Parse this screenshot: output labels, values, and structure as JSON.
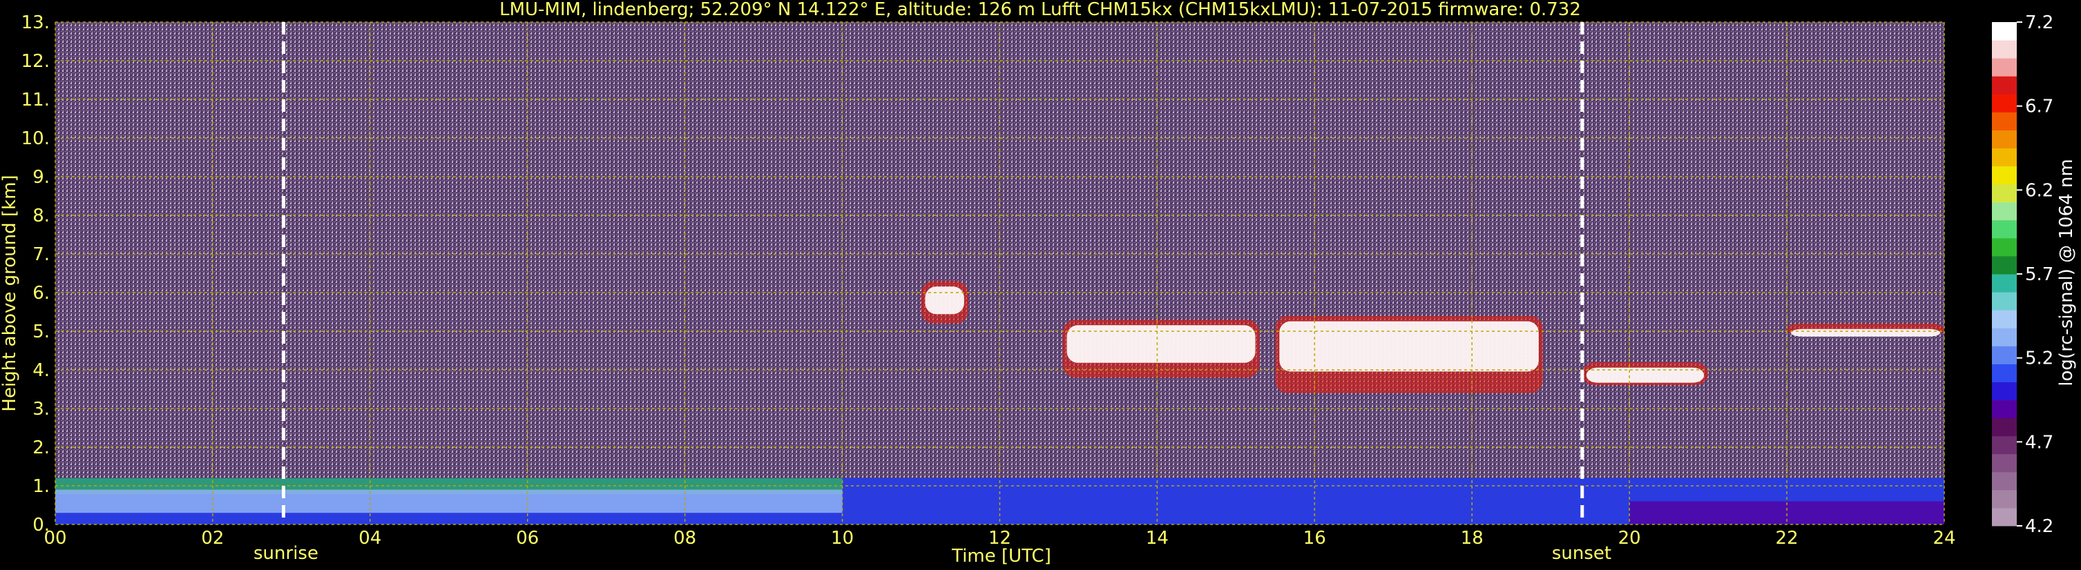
{
  "title": "LMU-MIM, lindenberg; 52.209° N 14.122° E, altitude: 126 m    Lufft CHM15kx (CHM15kxLMU): 11-07-2015    firmware: 0.732",
  "chart_data": {
    "type": "heatmap",
    "title": "LMU-MIM, lindenberg; 52.209° N 14.122° E, altitude: 126 m    Lufft CHM15kx (CHM15kxLMU): 11-07-2015    firmware: 0.732",
    "xlabel": "Time [UTC]",
    "ylabel": "Height above ground [km]",
    "xlim": [
      0,
      24
    ],
    "ylim": [
      0,
      13
    ],
    "x_ticks": [
      "00",
      "02",
      "04",
      "06",
      "08",
      "10",
      "12",
      "14",
      "16",
      "18",
      "20",
      "22",
      "24"
    ],
    "y_ticks": [
      "0.",
      "1.",
      "2.",
      "3.",
      "4.",
      "5.",
      "6.",
      "7.",
      "8.",
      "9.",
      "10.",
      "11.",
      "12.",
      "13."
    ],
    "grid": true,
    "colorbar": {
      "label": "log(rc-signal) @ 1064 nm",
      "ticks": [
        "4.2",
        "4.7",
        "5.2",
        "5.7",
        "6.2",
        "6.7",
        "7.2"
      ],
      "range": [
        4.2,
        7.2
      ],
      "colors": [
        "#b49ab4",
        "#a583a5",
        "#946b94",
        "#844f84",
        "#6e2f6e",
        "#5a0f5a",
        "#5500a0",
        "#2a18d8",
        "#2e4cf0",
        "#5f84f2",
        "#8fb2f4",
        "#a7cbf6",
        "#6fcfcf",
        "#2fb8a0",
        "#188830",
        "#30b830",
        "#50d870",
        "#9be89b",
        "#d6e640",
        "#f2e600",
        "#f2b800",
        "#f28c00",
        "#f25a00",
        "#f21800",
        "#d81818",
        "#f0a0a0",
        "#f8d8d8",
        "#ffffff"
      ]
    },
    "sunrise": {
      "label": "sunrise",
      "time": 2.9
    },
    "sunset": {
      "label": "sunset",
      "time": 19.4
    },
    "layers": [
      {
        "name": "boundary layer",
        "start": 0,
        "end": 24,
        "base_km": 0.0,
        "top_km": 1.2
      },
      {
        "name": "cloud",
        "start": 11.0,
        "end": 11.6,
        "base_km": 5.2,
        "top_km": 6.3
      },
      {
        "name": "cloud",
        "start": 12.8,
        "end": 15.3,
        "base_km": 3.8,
        "top_km": 5.3
      },
      {
        "name": "cloud",
        "start": 15.5,
        "end": 18.9,
        "base_km": 3.4,
        "top_km": 5.4
      },
      {
        "name": "cloud",
        "start": 19.4,
        "end": 21.0,
        "base_km": 3.6,
        "top_km": 4.2
      },
      {
        "name": "cloud",
        "start": 22.0,
        "end": 24.0,
        "base_km": 4.9,
        "top_km": 5.2
      }
    ]
  }
}
